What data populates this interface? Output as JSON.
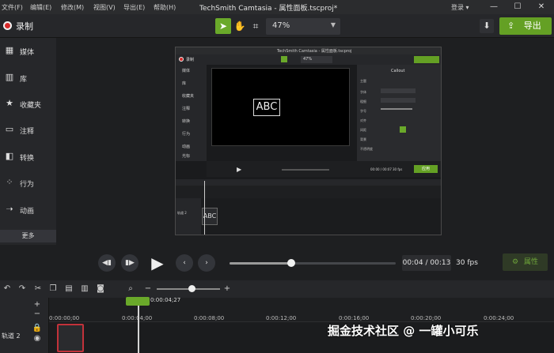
{
  "menu": {
    "items": [
      "文件(F)",
      "编辑(E)",
      "修改(M)",
      "视图(V)",
      "导出(E)",
      "帮助(H)"
    ],
    "app_title": "TechSmith Camtasia - 属性面板.tscproj*",
    "login": "登录 ▾",
    "window_buttons": [
      "—",
      "☐",
      "✕"
    ]
  },
  "toolbar": {
    "record_label": "录制",
    "zoom": "47%",
    "export_label": "导出",
    "accent_color": "#64a024",
    "record_color": "#d72a2a"
  },
  "sidebar": {
    "items": [
      {
        "icon": "film-strip-icon",
        "label": "媒体"
      },
      {
        "icon": "library-icon",
        "label": "库"
      },
      {
        "icon": "star-icon",
        "label": "收藏夹"
      },
      {
        "icon": "annotation-icon",
        "label": "注释"
      },
      {
        "icon": "transition-icon",
        "label": "转换"
      },
      {
        "icon": "behavior-icon",
        "label": "行为"
      },
      {
        "icon": "animation-icon",
        "label": "动画"
      }
    ],
    "more_label": "更多"
  },
  "canvas": {
    "nested": {
      "title": "TechSmith Camtasia - 属性面板.tscproj",
      "record_label": "录制",
      "zoom": "47%",
      "canvas_text": "ABC",
      "side_items": [
        "媒体",
        "库",
        "收藏夹",
        "注释",
        "转换",
        "行为",
        "动画",
        "光标"
      ],
      "props_title": "Callout",
      "props_rows": [
        "主题",
        "字体",
        "粗细",
        "字号",
        "对齐",
        "间距",
        "背景",
        "不透明度"
      ],
      "time": "00:00 / 00:07",
      "fps": "30 fps",
      "apply_label": "应用",
      "clip_text": "ABC",
      "track_label": "轨道 2"
    }
  },
  "player": {
    "time": "00:04 / 00:13",
    "fps": "30 fps",
    "properties_label": "属性",
    "progress": 0.37
  },
  "timeline": {
    "playhead_time": "0:00:04;27",
    "ticks": [
      "0:00:00;00",
      "0:00:04;00",
      "0:00:08;00",
      "0:00:12;00",
      "0:00:16;00",
      "0:00:20;00",
      "0:00:24;00"
    ],
    "track_label": "轨道 2",
    "zoom_level": 0.55
  },
  "watermark": "掘金技术社区 @ 一罐小可乐"
}
